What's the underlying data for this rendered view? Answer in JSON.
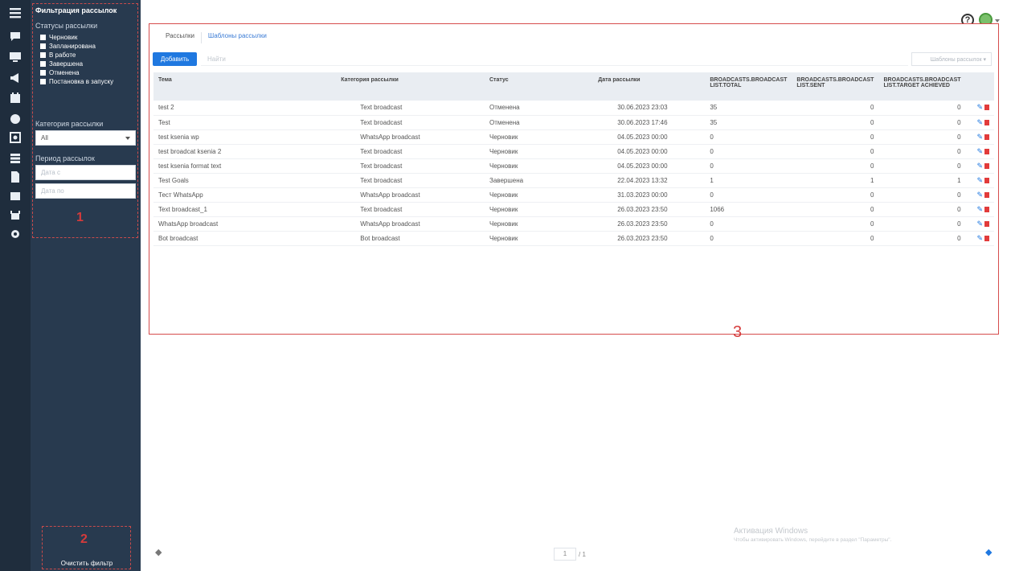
{
  "rail_icons": [
    "menu-icon",
    "chat-icon",
    "monitor-icon",
    "megaphone-icon",
    "calendar-icon",
    "clock-icon",
    "screen-icon",
    "database-icon",
    "document-icon",
    "table-icon",
    "robot-icon",
    "settings-icon"
  ],
  "filters": {
    "title": "Фильтрация рассылок",
    "status_label": "Статусы рассылки",
    "statuses": [
      "Черновик",
      "Запланирована",
      "В работе",
      "Завершена",
      "Отменена",
      "Постановка в запуску"
    ],
    "category_label": "Категория рассылки",
    "category_value": "All",
    "period_label": "Период рассылок",
    "date_from_placeholder": "Дата с",
    "date_to_placeholder": "Дата по",
    "annotation_1": "1",
    "annotation_2": "2",
    "clear_label": "Очистить фильтр"
  },
  "tabs": [
    "Рассылки",
    "Шаблоны рассылки"
  ],
  "toolbar": {
    "add_label": "Добавить",
    "search_placeholder": "Найти",
    "template_select": "Шаблоны рассылок ▾"
  },
  "table": {
    "columns": [
      "Тема",
      "Категория рассылки",
      "Статус",
      "Дата рассылки",
      "BROADCASTS.BROADCAST LIST.TOTAL",
      "BROADCASTS.BROADCAST LIST.SENT",
      "BROADCASTS.BROADCAST LIST.TARGET ACHIEVED"
    ],
    "rows": [
      {
        "topic": "test 2",
        "category": "Text broadcast",
        "status": "Отменена",
        "date": "30.06.2023 23:03",
        "total": "35",
        "sent": "0",
        "target": "0"
      },
      {
        "topic": "Test",
        "category": "Text broadcast",
        "status": "Отменена",
        "date": "30.06.2023 17:46",
        "total": "35",
        "sent": "0",
        "target": "0"
      },
      {
        "topic": "test ksenia wp",
        "category": "WhatsApp broadcast",
        "status": "Черновик",
        "date": "04.05.2023 00:00",
        "total": "0",
        "sent": "0",
        "target": "0"
      },
      {
        "topic": "test broadcat ksenia 2",
        "category": "Text broadcast",
        "status": "Черновик",
        "date": "04.05.2023 00:00",
        "total": "0",
        "sent": "0",
        "target": "0"
      },
      {
        "topic": "test ksenia format text",
        "category": "Text broadcast",
        "status": "Черновик",
        "date": "04.05.2023 00:00",
        "total": "0",
        "sent": "0",
        "target": "0"
      },
      {
        "topic": "Test Goals",
        "category": "Text broadcast",
        "status": "Завершена",
        "date": "22.04.2023 13:32",
        "total": "1",
        "sent": "1",
        "target": "1"
      },
      {
        "topic": "Тест WhatsApp",
        "category": "WhatsApp broadcast",
        "status": "Черновик",
        "date": "31.03.2023 00:00",
        "total": "0",
        "sent": "0",
        "target": "0"
      },
      {
        "topic": "Text broadcast_1",
        "category": "Text broadcast",
        "status": "Черновик",
        "date": "26.03.2023 23:50",
        "total": "1066",
        "sent": "0",
        "target": "0"
      },
      {
        "topic": "WhatsApp broadcast",
        "category": "WhatsApp broadcast",
        "status": "Черновик",
        "date": "26.03.2023 23:50",
        "total": "0",
        "sent": "0",
        "target": "0"
      },
      {
        "topic": "Bot broadcast",
        "category": "Bot broadcast",
        "status": "Черновик",
        "date": "26.03.2023 23:50",
        "total": "0",
        "sent": "0",
        "target": "0"
      }
    ]
  },
  "annotation_3": "3",
  "pager": {
    "current": "1",
    "total": "/ 1"
  },
  "watermark": {
    "line1": "Активация Windows",
    "line2": "Чтобы активировать Windows, перейдите в раздел \"Параметры\"."
  },
  "colors": {
    "sidebar": "#283a4f",
    "rail": "#1f2d3d",
    "accent": "#1f78e0",
    "annotation": "#d63b3b"
  }
}
